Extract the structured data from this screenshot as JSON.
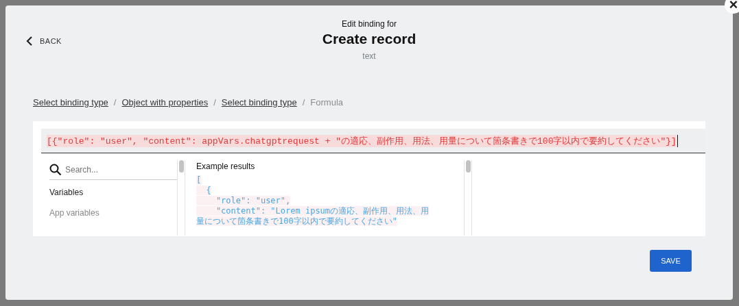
{
  "dialog": {
    "back": "BACK",
    "subtitle": "Edit binding for",
    "title": "Create record",
    "type": "text",
    "close": "×"
  },
  "breadcrumbs": [
    {
      "label": "Select binding type",
      "link": true
    },
    {
      "label": "Object with properties",
      "link": true
    },
    {
      "label": "Select binding type",
      "link": true
    },
    {
      "label": "Formula",
      "link": false
    }
  ],
  "separator": "/",
  "formula": "[{\"role\": \"user\", \"content\": appVars.chatgptrequest + \"の適応、副作用、用法、用量について箇条書きで100字以内で要約してください\"}]",
  "variables": {
    "search": {
      "placeholder": "Search..."
    },
    "heading": "Variables",
    "items": [
      "App variables"
    ]
  },
  "results": {
    "heading": "Example results",
    "lines": [
      "[",
      "  {",
      "    \"role\": \"user\",",
      "    \"content\": \"Lorem ipsumの適応、副作用、用法、用",
      "量について箇条書きで100字以内で要約してください\""
    ]
  },
  "save": "SAVE"
}
